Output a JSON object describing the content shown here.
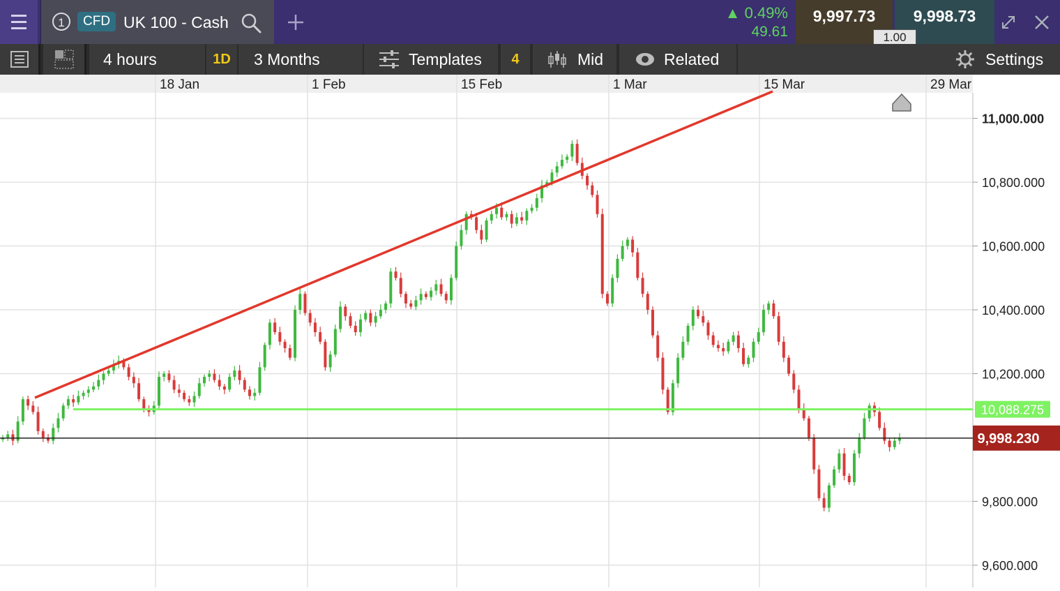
{
  "instrument": {
    "tab_number": "1",
    "badge": "CFD",
    "name": "UK 100 - Cash",
    "change_pct": "0.49%",
    "change_abs": "49.61",
    "sell_price": "9,997.73",
    "buy_price": "9,998.73",
    "spread": "1.00"
  },
  "toolbar": {
    "interval": "4 hours",
    "day_badge": "1D",
    "range": "3 Months",
    "templates_label": "Templates",
    "templates_count": "4",
    "price_mode": "Mid",
    "related_label": "Related",
    "settings_label": "Settings"
  },
  "colors": {
    "up": "#3fb83f",
    "down": "#d93b3b",
    "trendline": "#e2372b",
    "support": "#7ef262",
    "current_price_bg": "#a5241d"
  },
  "chart_data": {
    "type": "candlestick",
    "x_labels": [
      "18 Jan",
      "1 Feb",
      "15 Feb",
      "1 Mar",
      "15 Mar",
      "29 Mar"
    ],
    "y_ticks": [
      "11,000.000",
      "10,800.000",
      "10,600.000",
      "10,400.000",
      "10,200.000",
      "9,800.000",
      "9,600.000"
    ],
    "ylim": [
      9530,
      11080
    ],
    "support_level": 10088.275,
    "support_label": "10,088.275",
    "current_price": 9998.23,
    "current_price_label": "9,998.230",
    "closes": [
      10000,
      10010,
      9990,
      10050,
      10120,
      10100,
      10080,
      10020,
      10000,
      9990,
      10030,
      10060,
      10100,
      10120,
      10110,
      10130,
      10140,
      10150,
      10160,
      10180,
      10200,
      10210,
      10230,
      10240,
      10220,
      10190,
      10170,
      10120,
      10090,
      10080,
      10100,
      10190,
      10200,
      10180,
      10150,
      10140,
      10120,
      10110,
      10130,
      10170,
      10190,
      10200,
      10180,
      10160,
      10150,
      10190,
      10210,
      10180,
      10150,
      10130,
      10140,
      10220,
      10290,
      10360,
      10330,
      10300,
      10280,
      10250,
      10400,
      10450,
      10390,
      10360,
      10330,
      10300,
      10220,
      10260,
      10340,
      10410,
      10380,
      10350,
      10330,
      10370,
      10390,
      10360,
      10380,
      10400,
      10420,
      10520,
      10500,
      10450,
      10420,
      10410,
      10430,
      10450,
      10440,
      10460,
      10480,
      10450,
      10430,
      10500,
      10600,
      10650,
      10700,
      10690,
      10650,
      10620,
      10680,
      10700,
      10720,
      10690,
      10700,
      10670,
      10690,
      10680,
      10710,
      10720,
      10750,
      10790,
      10800,
      10830,
      10850,
      10870,
      10880,
      10920,
      10860,
      10820,
      10790,
      10760,
      10700,
      10450,
      10420,
      10500,
      10560,
      10600,
      10620,
      10580,
      10500,
      10450,
      10400,
      10320,
      10250,
      10150,
      10080,
      10170,
      10250,
      10300,
      10350,
      10400,
      10380,
      10360,
      10320,
      10290,
      10280,
      10270,
      10300,
      10320,
      10280,
      10230,
      10250,
      10300,
      10330,
      10400,
      10420,
      10380,
      10300,
      10250,
      10200,
      10150,
      10090,
      10060,
      10000,
      9900,
      9810,
      9780,
      9850,
      9900,
      9950,
      9880,
      9860,
      9950,
      10000,
      10060,
      10100,
      10080,
      10030,
      9990,
      9970,
      9990,
      10000
    ]
  }
}
